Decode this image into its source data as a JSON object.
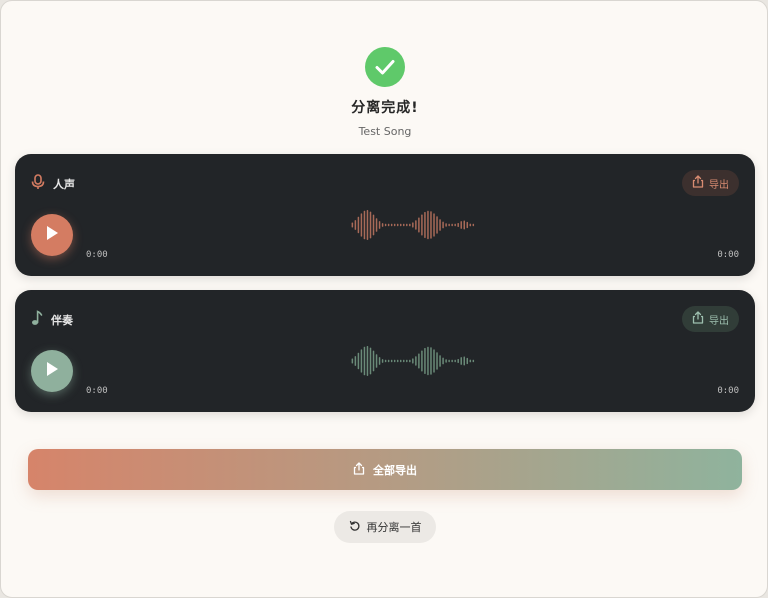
{
  "window": {
    "title": ""
  },
  "header": {
    "title": "分离完成!",
    "song_name": "Test Song"
  },
  "tracks": [
    {
      "name": "人声",
      "icon": "microphone-icon",
      "export_label": "导出",
      "current_time": "0:00",
      "duration": "0:00",
      "accent": "#d47c62"
    },
    {
      "name": "伴奏",
      "icon": "music-note-icon",
      "export_label": "导出",
      "current_time": "0:00",
      "duration": "0:00",
      "accent": "#8fb09d"
    }
  ],
  "actions": {
    "export_all_label": "全部导出",
    "separate_again_label": "再分离一首"
  },
  "colors": {
    "background": "#fcf9f5",
    "card": "#222528",
    "success": "#5fc96a",
    "vocal_accent": "#d47c62",
    "accompaniment_accent": "#8fb09d"
  }
}
